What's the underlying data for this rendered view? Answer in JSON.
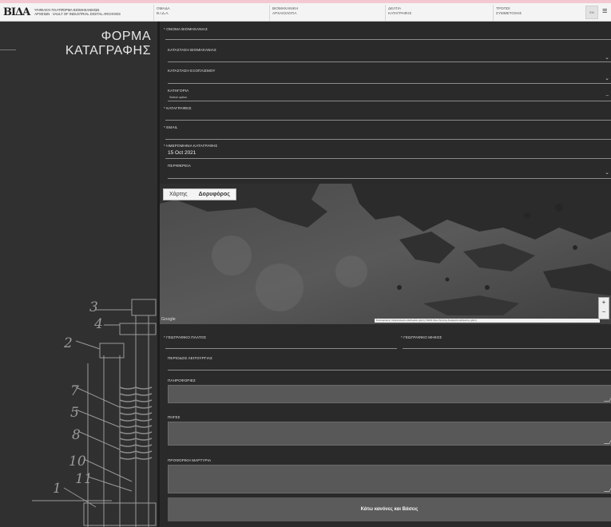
{
  "header": {
    "logo_mark": "ΒΙΔΑ",
    "logo_line1": "Ψηφιακή πλατφόρμα Βιομηχανικών",
    "logo_line2": "Αρχείων · Vault of Industrial Digital Archives",
    "nav": [
      {
        "line1": "ΟΜΑΔΑ",
        "line2": "Β.Ι.Δ.Α."
      },
      {
        "line1": "ΒΙΟΜΗΧΑΝΙΚΗ",
        "line2": "ΑΡΧΑΙΟΛΟΓΙΑ"
      },
      {
        "line1": "ΔΕΛΤΙΑ",
        "line2": "ΚΑΤΑΓΡΑΦΗΣ"
      },
      {
        "line1": "ΤΡΟΠΟΙ",
        "line2": "ΣΥΜΜΕΤΟΧΗΣ"
      }
    ],
    "lang_box": "EN",
    "menu_icon": "hamburger-icon"
  },
  "sidebar": {
    "title_line1": "ΦΟΡΜΑ",
    "title_line2": "ΚΑΤΑΓΡΑΦΗΣ",
    "drawing_labels": [
      "3",
      "4",
      "2",
      "7",
      "5",
      "8",
      "10",
      "11",
      "1"
    ]
  },
  "form": {
    "factory_name": {
      "label": "* ΟΝΟΜΑ ΒΙΟΜΗΧΑΝΙΑΣ",
      "value": ""
    },
    "factory_status": {
      "label": "ΚΑΤΑΣΤΑΣΗ ΒΙΟΜΗΧΑΝΙΑΣ",
      "value": ""
    },
    "equipment_status": {
      "label": "ΚΑΤΑΣΤΑΣΗ ΕΞΟΠΛΙΣΜΟΥ",
      "value": ""
    },
    "category": {
      "label": "ΚΑΤΗΓΟΡΙΑ",
      "value": "Select option"
    },
    "recorders": {
      "label": "* ΚΑΤΑΓΡΑΦΕΙΣ",
      "value": ""
    },
    "email": {
      "label": "* EMAIL",
      "value": ""
    },
    "record_date": {
      "label": "* ΗΜΕΡΟΜΗΝΙΑ ΚΑΤΑΓΡΑΦΗΣ",
      "value": "15 Oct 2021"
    },
    "region": {
      "label": "ΠΕΡΙΦΕΡΕΙΑ",
      "value": ""
    },
    "map": {
      "tabs": [
        "Χάρτης",
        "Δορυφόρος"
      ],
      "selected_tab": "Δορυφόρος",
      "google_label": "Google",
      "footer_text": "Συντομεύσεις πληκτρολογίου  Δεδομένα χάρτη ©2021  Όροι Χρήσης  Αναφορά σφάλματος χάρτη"
    },
    "latitude": {
      "label": "* ΓΕΩΓΡΑΦΙΚΟ ΠΛΑΤΟΣ",
      "value": ""
    },
    "longitude": {
      "label": "* ΓΕΩΓΡΑΦΙΚΟ ΜΗΚΟΣ",
      "value": ""
    },
    "operation_period": {
      "label": "ΠΕΡΙΟΔΟΣ ΛΕΙΤΟΥΡΓΙΑΣ",
      "value": ""
    },
    "info": {
      "label": "ΠΛΗΡΟΦΟΡΙΕΣ",
      "value": ""
    },
    "sources": {
      "label": "ΠΗΓΕΣ",
      "value": ""
    },
    "oral_testimony": {
      "label": "ΠΡΟΦΟΡΙΚΗ ΜΑΡΤΥΡΙΑ",
      "value": ""
    },
    "submit_label": "Κάτω κανόνες και Βάσεις"
  },
  "colors": {
    "panel": "#303030",
    "form_bg": "#2a2a2a",
    "textarea": "#585858",
    "pink_bar": "#f2c9d2"
  }
}
